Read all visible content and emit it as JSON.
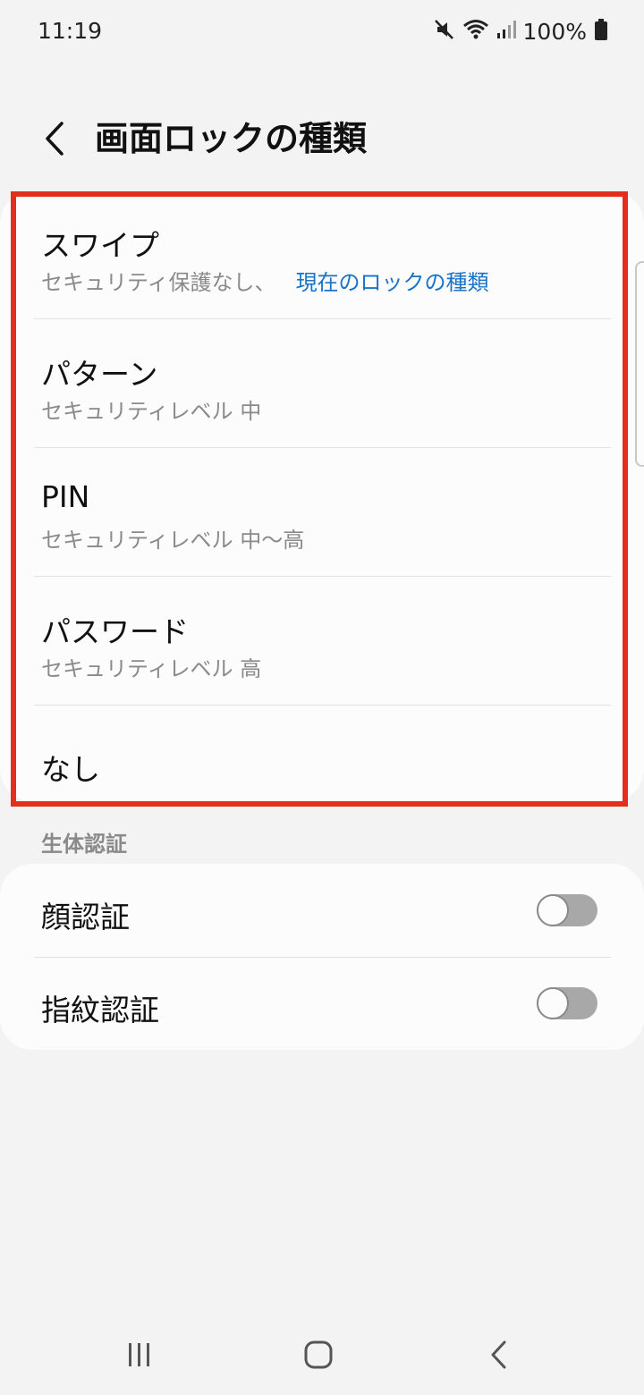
{
  "status_bar": {
    "time": "11:19",
    "battery": "100%",
    "icons": [
      "mute-icon",
      "wifi-icon",
      "signal-icon",
      "battery-icon"
    ]
  },
  "header": {
    "title": "画面ロックの種類"
  },
  "lock_types": [
    {
      "title": "スワイプ",
      "subtitle": "セキュリティ保護なし、",
      "current_label": "現在のロックの種類"
    },
    {
      "title": "パターン",
      "subtitle": "セキュリティレベル 中"
    },
    {
      "title": "PIN",
      "subtitle": "セキュリティレベル 中〜高"
    },
    {
      "title": "パスワード",
      "subtitle": "セキュリティレベル 高"
    },
    {
      "title": "なし"
    }
  ],
  "biometrics": {
    "section_label": "生体認証",
    "items": [
      {
        "title": "顔認証",
        "enabled": false
      },
      {
        "title": "指紋認証",
        "enabled": false
      }
    ]
  },
  "colors": {
    "accent": "#1a73c9",
    "highlight": "#e3301c",
    "background": "#f3f3f3",
    "card": "#fcfcfc"
  },
  "nav": {
    "icons": [
      "recent-apps-icon",
      "home-icon",
      "back-icon"
    ]
  }
}
